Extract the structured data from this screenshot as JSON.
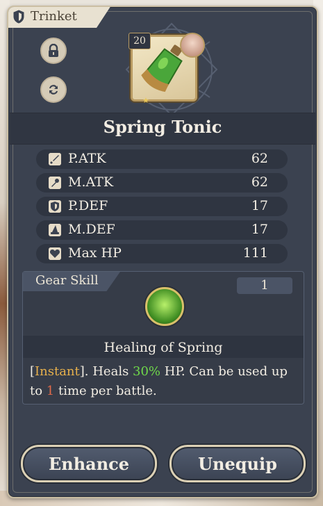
{
  "panel": {
    "category_label": "Trinket"
  },
  "item": {
    "name": "Spring Tonic",
    "level": "20"
  },
  "stats": [
    {
      "label": "P.ATK",
      "value": "62",
      "icon": "sword-icon"
    },
    {
      "label": "M.ATK",
      "value": "62",
      "icon": "wand-icon"
    },
    {
      "label": "P.DEF",
      "value": "17",
      "icon": "shield-icon"
    },
    {
      "label": "M.DEF",
      "value": "17",
      "icon": "wizard-hat-icon"
    },
    {
      "label": "Max HP",
      "value": "111",
      "icon": "heart-icon"
    }
  ],
  "gear_skill": {
    "tab_label": "Gear Skill",
    "level": "1",
    "name": "Healing of Spring",
    "desc_open_bracket": "[",
    "desc_tag": "Instant",
    "desc_part1": "]. Heals ",
    "desc_percent": "30%",
    "desc_part2": " HP. Can be used up to ",
    "desc_count": "1",
    "desc_part3": " time per battle."
  },
  "buttons": {
    "enhance": "Enhance",
    "unequip": "Unequip"
  },
  "colors": {
    "panel_bg": "#3b4250",
    "frame_border": "#cbbfa4",
    "highlight_gold": "#e6b04c",
    "highlight_green": "#6fd84a",
    "highlight_red": "#e06a4a"
  }
}
